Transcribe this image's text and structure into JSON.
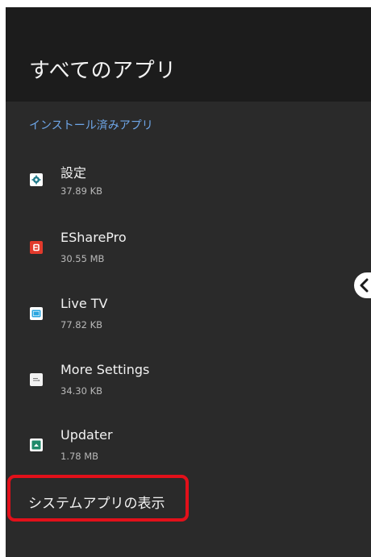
{
  "header": {
    "title": "すべてのアプリ"
  },
  "section": {
    "label": "インストール済みアプリ"
  },
  "apps": [
    {
      "name": "設定",
      "size": "37.89 KB",
      "icon": "settings-gear-icon",
      "icon_color": "#ffffff"
    },
    {
      "name": "ESharePro",
      "size": "30.55 MB",
      "icon": "eshare-icon",
      "icon_color": "#e23a2c"
    },
    {
      "name": "Live TV",
      "size": "77.82 KB",
      "icon": "tv-icon",
      "icon_color": "#2aa6e0"
    },
    {
      "name": "More Settings",
      "size": "34.30 KB",
      "icon": "more-settings-icon",
      "icon_color": "#f2f2f2"
    },
    {
      "name": "Updater",
      "size": "1.78 MB",
      "icon": "updater-icon",
      "icon_color": "#1f8a6a"
    }
  ],
  "system_apps": {
    "label": "システムアプリの表示"
  },
  "side_tab": {
    "icon": "chevron-left-icon"
  },
  "colors": {
    "background": "#2a2a2a",
    "header_background": "#1c1c1c",
    "section_accent": "#6ea6e8",
    "highlight": "#e2101a"
  }
}
